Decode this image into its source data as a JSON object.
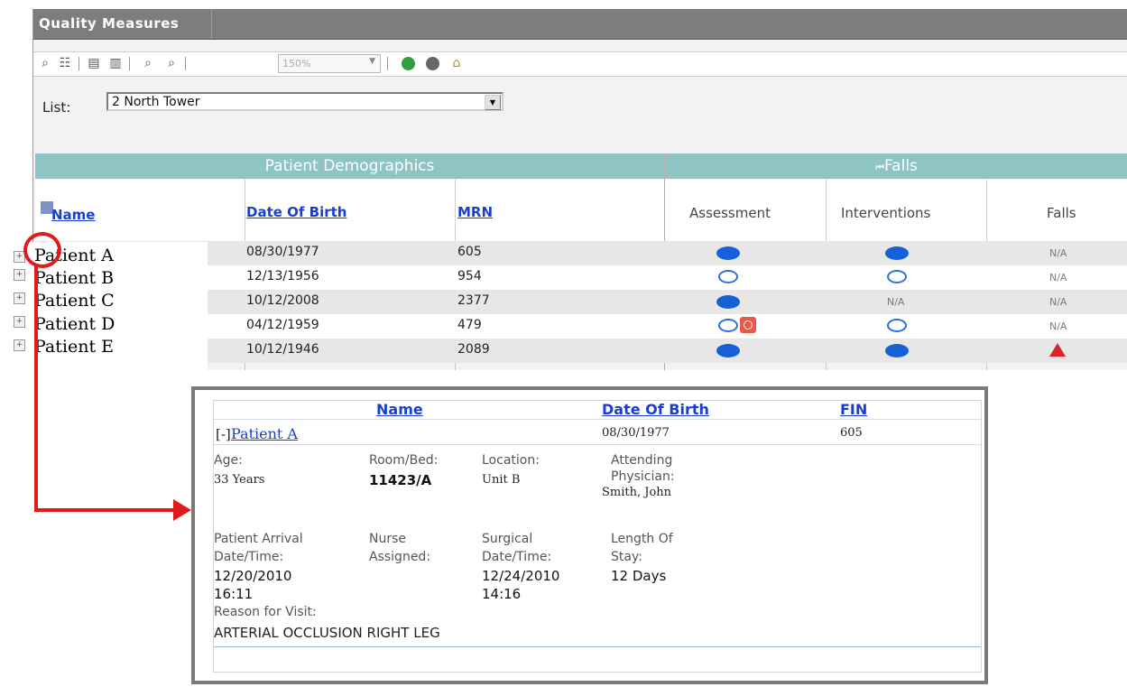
{
  "window": {
    "title": "Quality Measures"
  },
  "toolbar": {
    "zoom_value": "150%"
  },
  "list": {
    "label": "List:",
    "selected": "2 North Tower"
  },
  "grid": {
    "groups": {
      "demographics": "Patient Demographics",
      "falls": "Falls",
      "falls_nav_icon": "first-page-icon"
    },
    "columns": {
      "name": "Name",
      "dob": "Date Of Birth",
      "mrn": "MRN",
      "assessment": "Assessment",
      "interventions": "Interventions",
      "falls": "Falls"
    },
    "rows": [
      {
        "name": "Patient A",
        "dob": "08/30/1977",
        "mrn": "605",
        "assessment": "filled",
        "interventions": "filled",
        "falls": "N/A"
      },
      {
        "name": "Patient B",
        "dob": "12/13/1956",
        "mrn": "954",
        "assessment": "open",
        "interventions": "open",
        "falls": "N/A"
      },
      {
        "name": "Patient C",
        "dob": "10/12/2008",
        "mrn": "2377",
        "assessment": "filled",
        "interventions": "N/A",
        "falls": "N/A"
      },
      {
        "name": "Patient D",
        "dob": "04/12/1959",
        "mrn": "479",
        "assessment": "open+clock",
        "interventions": "open",
        "falls": "N/A"
      },
      {
        "name": "Patient E",
        "dob": "10/12/1946",
        "mrn": "2089",
        "assessment": "filled",
        "interventions": "filled",
        "falls": "alert"
      }
    ]
  },
  "detail": {
    "headers": {
      "name": "Name",
      "dob": "Date Of Birth",
      "fin": "FIN"
    },
    "collapse": "[-]",
    "patient": "Patient A",
    "dob": "08/30/1977",
    "fin": "605",
    "age_label": "Age:",
    "age": "33 Years",
    "room_label": "Room/Bed:",
    "room": "11423/A",
    "location_label": "Location:",
    "location": "Unit B",
    "attending_label_1": "Attending",
    "attending_label_2": "Physician:",
    "attending": "Smith, John",
    "arrival_label_1": "Patient Arrival",
    "arrival_label_2": "Date/Time:",
    "arrival_date": "12/20/2010",
    "arrival_time": "16:11",
    "nurse_label_1": "Nurse",
    "nurse_label_2": "Assigned:",
    "surgical_label_1": "Surgical",
    "surgical_label_2": "Date/Time:",
    "surgical_date": "12/24/2010",
    "surgical_time": "14:16",
    "los_label_1": "Length Of",
    "los_label_2": "Stay:",
    "los": "12 Days",
    "reason_label": "Reason for Visit:",
    "reason": "ARTERIAL OCCLUSION RIGHT LEG"
  },
  "colors": {
    "header_teal": "#8fc4c4",
    "link_blue": "#1a3fcf",
    "annotation_red": "#e01b1b",
    "status_blue": "#1560d8"
  }
}
